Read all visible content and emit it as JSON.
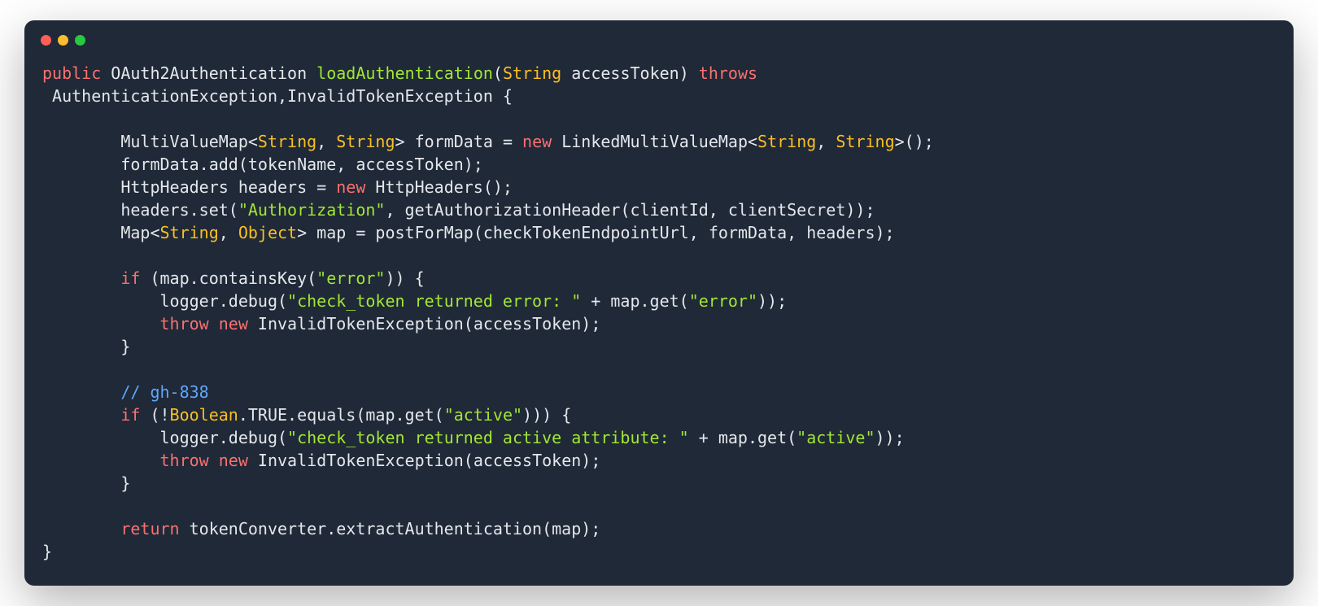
{
  "window": {
    "traffic_lights": [
      "red",
      "yellow",
      "green"
    ]
  },
  "code": {
    "tokens": [
      {
        "t": "public",
        "c": "kw"
      },
      {
        "t": " OAuth2Authentication "
      },
      {
        "t": "loadAuthentication",
        "c": "fn"
      },
      {
        "t": "("
      },
      {
        "t": "String",
        "c": "type"
      },
      {
        "t": " accessToken) "
      },
      {
        "t": "throws",
        "c": "kw"
      },
      {
        "t": "\n AuthenticationException,InvalidTokenException {\n\n        MultiValueMap<"
      },
      {
        "t": "String",
        "c": "type"
      },
      {
        "t": ", "
      },
      {
        "t": "String",
        "c": "type"
      },
      {
        "t": "> formData = "
      },
      {
        "t": "new",
        "c": "kw"
      },
      {
        "t": " LinkedMultiValueMap<"
      },
      {
        "t": "String",
        "c": "type"
      },
      {
        "t": ", "
      },
      {
        "t": "String",
        "c": "type"
      },
      {
        "t": ">();\n        formData.add(tokenName, accessToken);\n        HttpHeaders headers = "
      },
      {
        "t": "new",
        "c": "kw"
      },
      {
        "t": " HttpHeaders();\n        headers.set("
      },
      {
        "t": "\"Authorization\"",
        "c": "str"
      },
      {
        "t": ", getAuthorizationHeader(clientId, clientSecret));\n        Map<"
      },
      {
        "t": "String",
        "c": "type"
      },
      {
        "t": ", "
      },
      {
        "t": "Object",
        "c": "type"
      },
      {
        "t": "> map = postForMap(checkTokenEndpointUrl, formData, headers);\n\n        "
      },
      {
        "t": "if",
        "c": "kw"
      },
      {
        "t": " (map.containsKey("
      },
      {
        "t": "\"error\"",
        "c": "str"
      },
      {
        "t": ")) {\n            logger.debug("
      },
      {
        "t": "\"check_token returned error: \"",
        "c": "str"
      },
      {
        "t": " + map.get("
      },
      {
        "t": "\"error\"",
        "c": "str"
      },
      {
        "t": "));\n            "
      },
      {
        "t": "throw",
        "c": "kw"
      },
      {
        "t": " "
      },
      {
        "t": "new",
        "c": "kw"
      },
      {
        "t": " InvalidTokenException(accessToken);\n        }\n\n        "
      },
      {
        "t": "// gh-838",
        "c": "comment"
      },
      {
        "t": "\n        "
      },
      {
        "t": "if",
        "c": "kw"
      },
      {
        "t": " (!"
      },
      {
        "t": "Boolean",
        "c": "type"
      },
      {
        "t": ".TRUE.equals(map.get("
      },
      {
        "t": "\"active\"",
        "c": "str"
      },
      {
        "t": "))) {\n            logger.debug("
      },
      {
        "t": "\"check_token returned active attribute: \"",
        "c": "str"
      },
      {
        "t": " + map.get("
      },
      {
        "t": "\"active\"",
        "c": "str"
      },
      {
        "t": "));\n            "
      },
      {
        "t": "throw",
        "c": "kw"
      },
      {
        "t": " "
      },
      {
        "t": "new",
        "c": "kw"
      },
      {
        "t": " InvalidTokenException(accessToken);\n        }\n\n        "
      },
      {
        "t": "return",
        "c": "kw"
      },
      {
        "t": " tokenConverter.extractAuthentication(map);\n}"
      }
    ]
  }
}
